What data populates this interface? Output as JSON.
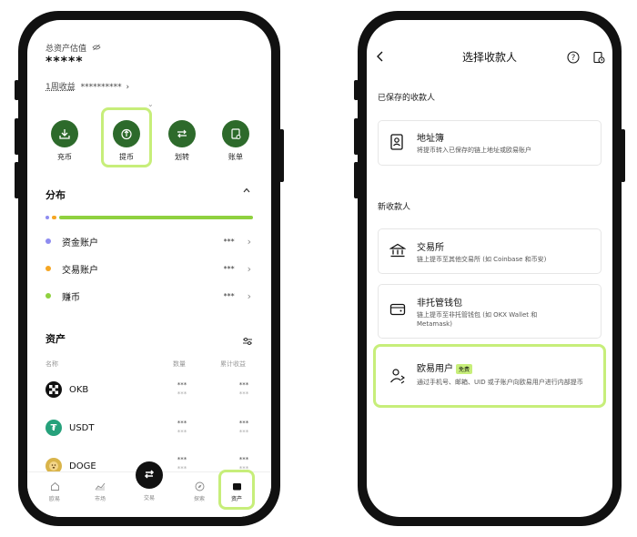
{
  "left": {
    "total_label": "总资产估值",
    "total_value": "*****",
    "week_label": "1周收益",
    "week_value": "**********",
    "actions": [
      {
        "label": "充币"
      },
      {
        "label": "提币"
      },
      {
        "label": "划转"
      },
      {
        "label": "账单"
      }
    ],
    "distribution": {
      "title": "分布",
      "items": [
        {
          "label": "资金账户",
          "value": "***",
          "color": "#8e8cf0"
        },
        {
          "label": "交易账户",
          "value": "***",
          "color": "#f5a623"
        },
        {
          "label": "赚币",
          "value": "***",
          "color": "#8fd13f"
        }
      ]
    },
    "assets": {
      "title": "资产",
      "col_name": "名称",
      "col_qty": "数量",
      "col_pnl": "累计收益",
      "rows": [
        {
          "name": "OKB",
          "qty": "***",
          "qty_sub": "***",
          "pnl": "***",
          "pnl_sub": "***"
        },
        {
          "name": "USDT",
          "qty": "***",
          "qty_sub": "***",
          "pnl": "***",
          "pnl_sub": "***"
        },
        {
          "name": "DOGE",
          "qty": "***",
          "qty_sub": "***",
          "pnl": "***",
          "pnl_sub": "***"
        }
      ]
    },
    "tabs": [
      {
        "label": "欧易"
      },
      {
        "label": "市场"
      },
      {
        "label": "交易"
      },
      {
        "label": "探索"
      },
      {
        "label": "资产"
      }
    ]
  },
  "right": {
    "title": "选择收款人",
    "saved_header": "已保存的收款人",
    "new_header": "新收款人",
    "address_book": {
      "title": "地址簿",
      "desc": "将提币转入已保存的链上地址或欧易账户"
    },
    "exchange": {
      "title": "交易所",
      "desc": "链上提币至其他交易所 (如 Coinbase 和币安)"
    },
    "wallet": {
      "title": "非托管钱包",
      "desc": "链上提币至非托管钱包 (如 OKX Wallet 和 Metamask)"
    },
    "okx_user": {
      "title": "欧易用户",
      "badge": "免费",
      "desc": "通过手机号、邮箱、UID 或子账户向欧易用户进行内部提币"
    }
  },
  "colors": {
    "accent_green": "#2d6a2b",
    "highlight": "#c7ee7a"
  }
}
